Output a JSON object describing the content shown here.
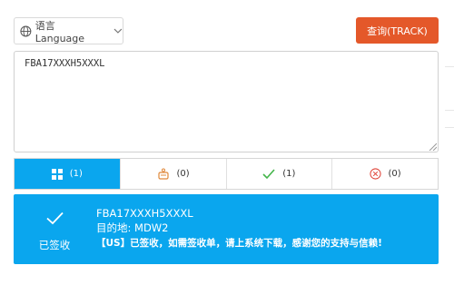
{
  "language_select": {
    "label": "语言 Language"
  },
  "track_button": {
    "label": "查询(TRACK)"
  },
  "input": {
    "value": "FBA17XXXH5XXXL"
  },
  "tabs": [
    {
      "count": "(1)",
      "icon": "grid-icon",
      "active": true
    },
    {
      "count": "(0)",
      "icon": "transit-icon",
      "active": false
    },
    {
      "count": "(1)",
      "icon": "check-icon",
      "active": false
    },
    {
      "count": "(0)",
      "icon": "close-circle-icon",
      "active": false
    }
  ],
  "result": {
    "status": "已签收",
    "tracking_number": "FBA17XXXH5XXXL",
    "destination": "目的地: MDW2",
    "notice": "【US】已签收，如需签收单，请上系统下载，感谢您的支持与信赖!"
  },
  "colors": {
    "accent": "#0aa6ee",
    "track_button": "#e4582a",
    "success": "#43b54a",
    "error": "#e0453a"
  }
}
